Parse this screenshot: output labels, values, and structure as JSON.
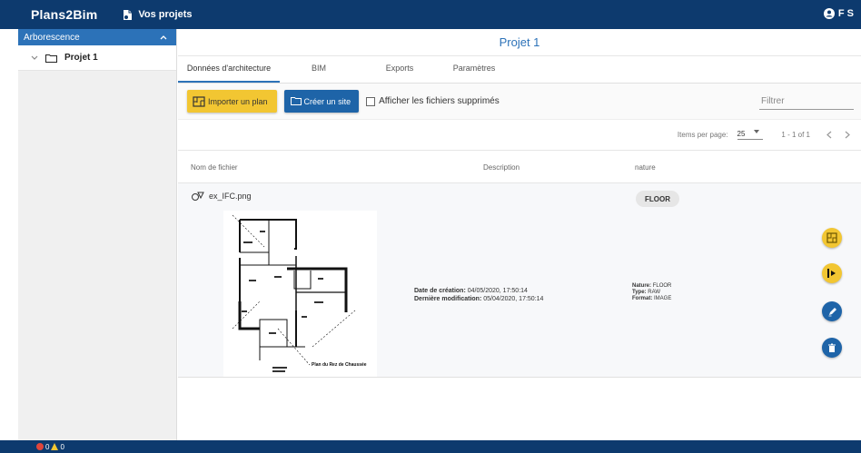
{
  "app": {
    "brand": "Plans2Bim",
    "projects_label": "Vos projets",
    "user_initials": "F S"
  },
  "sidebar": {
    "header": "Arborescence",
    "items": [
      {
        "label": "Projet 1"
      }
    ]
  },
  "main": {
    "title": "Projet 1",
    "tabs": [
      {
        "label": "Données d'architecture",
        "active": true
      },
      {
        "label": "BIM",
        "active": false
      },
      {
        "label": "Exports",
        "active": false
      },
      {
        "label": "Paramètres",
        "active": false
      }
    ],
    "toolbar": {
      "import_label": "Importer un plan",
      "create_site_label": "Créer un site",
      "show_deleted_label": "Afficher les fichiers supprimés",
      "filter_placeholder": "Filtrer"
    },
    "pager": {
      "items_per_page_label": "Items per page:",
      "items_per_page_value": "25",
      "range": "1 - 1 of 1"
    },
    "table": {
      "columns": [
        "Nom de fichier",
        "Description",
        "nature"
      ],
      "rows": [
        {
          "filename": "ex_IFC.png",
          "plan_caption": "Plan du Rez de Chaussée",
          "created_label": "Date de création:",
          "created_value": "04/05/2020, 17:50:14",
          "modified_label": "Dernière modification:",
          "modified_value": "05/04/2020, 17:50:14",
          "nature_badge": "FLOOR",
          "nature_label": "Nature:",
          "nature_value": "FLOOR",
          "type_label": "Type:",
          "type_value": "RAW",
          "format_label": "Format:",
          "format_value": "IMAGE"
        }
      ]
    }
  },
  "status": {
    "errors": "0",
    "warnings": "0"
  },
  "colors": {
    "navy": "#0d3a6e",
    "blue": "#1e64a8",
    "accent": "#2c72b8",
    "yellow": "#f2c632"
  }
}
